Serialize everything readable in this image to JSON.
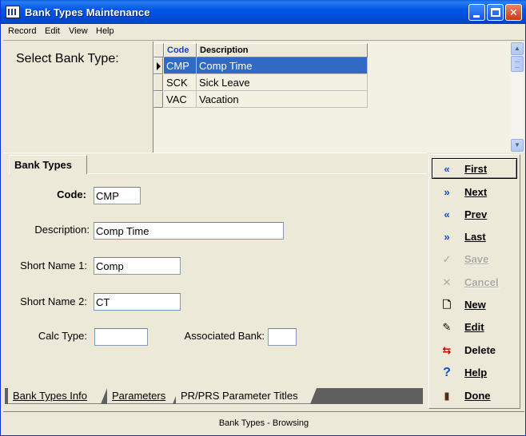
{
  "window": {
    "title": "Bank Types Maintenance"
  },
  "menu": {
    "items": [
      {
        "label": "Record"
      },
      {
        "label": "Edit"
      },
      {
        "label": "View"
      },
      {
        "label": "Help"
      }
    ]
  },
  "select": {
    "label": "Select Bank Type:",
    "columns": [
      "Code",
      "Description"
    ],
    "rows": [
      {
        "code": "CMP",
        "description": "Comp Time",
        "selected": true
      },
      {
        "code": "SCK",
        "description": "Sick Leave",
        "selected": false
      },
      {
        "code": "VAC",
        "description": "Vacation",
        "selected": false
      }
    ]
  },
  "form": {
    "tab_title": "Bank Types",
    "code_label": "Code:",
    "code_value": "CMP",
    "description_label": "Description:",
    "description_value": "Comp Time",
    "short_name1_label": "Short Name 1:",
    "short_name1_value": "Comp",
    "short_name2_label": "Short Name 2:",
    "short_name2_value": "CT",
    "calc_type_label": "Calc Type:",
    "calc_type_value": "",
    "associated_bank_label": "Associated Bank:",
    "associated_bank_value": ""
  },
  "bottom_tabs": [
    {
      "label": "Bank Types Info",
      "active": true
    },
    {
      "label": "Parameters",
      "active": false
    },
    {
      "label": "PR/PRS Parameter Titles",
      "active": false
    }
  ],
  "nav_buttons": [
    {
      "label": "First",
      "icon": "first-icon",
      "enabled": true
    },
    {
      "label": "Next",
      "icon": "next-icon",
      "enabled": true
    },
    {
      "label": "Prev",
      "icon": "prev-icon",
      "enabled": true
    },
    {
      "label": "Last",
      "icon": "last-icon",
      "enabled": true
    },
    {
      "label": "Save",
      "icon": "checkmark-icon",
      "enabled": false
    },
    {
      "label": "Cancel",
      "icon": "x-icon",
      "enabled": false
    },
    {
      "label": "New",
      "icon": "new-document-icon",
      "enabled": true
    },
    {
      "label": "Edit",
      "icon": "edit-document-icon",
      "enabled": true
    },
    {
      "label": "Delete",
      "icon": "delete-icon",
      "enabled": true
    },
    {
      "label": "Help",
      "icon": "question-icon",
      "enabled": true
    },
    {
      "label": "Done",
      "icon": "done-door-icon",
      "enabled": true
    }
  ],
  "status": {
    "text": "Bank Types - Browsing"
  },
  "colors": {
    "selection": "#316ac5",
    "title_bar": "#0058e6",
    "header_text": "#1a3fbd"
  }
}
